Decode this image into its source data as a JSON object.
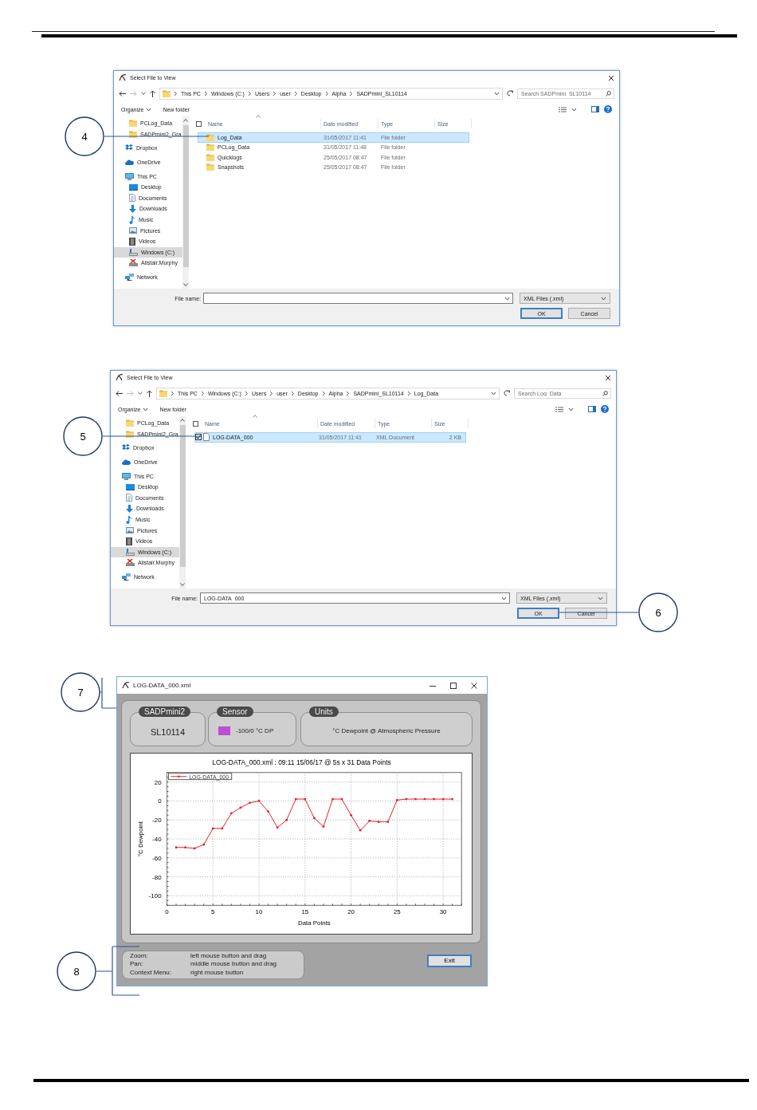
{
  "dialogs": [
    {
      "title": "Select File to View",
      "callouts": [
        "4"
      ],
      "address": [
        "This PC",
        "Windows (C:)",
        "Users",
        "user",
        "Desktop",
        "Alpha",
        "SADPmini_SL10114"
      ],
      "search": {
        "placeholder": "Search SADPmini_SL10114"
      },
      "commands": [
        "Organize",
        "New folder"
      ],
      "sidebar": [
        {
          "label": "PCLog_Data",
          "kind": "folder",
          "selected": false
        },
        {
          "label": "SADPmini2_Gra",
          "kind": "folder",
          "selected": false
        },
        {
          "label": "Dropbox",
          "kind": "dropbox",
          "selected": false
        },
        {
          "label": "OneDrive",
          "kind": "cloud",
          "selected": false
        },
        {
          "label": "This PC",
          "kind": "pc",
          "selected": false,
          "children": [
            {
              "label": "Desktop",
              "kind": "desktop",
              "selected": false
            },
            {
              "label": "Documents",
              "kind": "documents",
              "selected": false
            },
            {
              "label": "Downloads",
              "kind": "downloads",
              "selected": false
            },
            {
              "label": "Music",
              "kind": "music",
              "selected": false
            },
            {
              "label": "Pictures",
              "kind": "pictures",
              "selected": false
            },
            {
              "label": "Videos",
              "kind": "videos",
              "selected": false
            },
            {
              "label": "Windows (C:)",
              "kind": "drive",
              "selected": true
            },
            {
              "label": "Alistair.Murphy",
              "kind": "share",
              "selected": false
            }
          ]
        },
        {
          "label": "Network",
          "kind": "network",
          "selected": false
        }
      ],
      "columns": [
        "Name",
        "Date modified",
        "Type",
        "Size"
      ],
      "select_all": {
        "checked": false
      },
      "rows": [
        {
          "kind": "folder",
          "name": "Log_Data",
          "date": "31/05/2017 11:41",
          "type": "File folder",
          "selected": true
        },
        {
          "kind": "folder",
          "name": "PCLog_Data",
          "date": "31/05/2017 11:48",
          "type": "File folder",
          "selected": false
        },
        {
          "kind": "folder",
          "name": "Quicklogs",
          "date": "25/05/2017 08:47",
          "type": "File folder",
          "selected": false
        },
        {
          "kind": "folder",
          "name": "Snapshots",
          "date": "25/05/2017 08:47",
          "type": "File folder",
          "selected": false
        }
      ],
      "file_name": {
        "label": "File name:"
      },
      "file_type": "XML Files (.xml)",
      "buttons": [
        "OK",
        "Cancel"
      ]
    },
    {
      "title": "Select File to View",
      "callouts": [
        "5",
        "6"
      ],
      "address": [
        "This PC",
        "Windows (C:)",
        "Users",
        "user",
        "Desktop",
        "Alpha",
        "SADPmini_SL10114",
        "Log_Data"
      ],
      "search": {
        "placeholder": "Search Log_Data"
      },
      "commands": [
        "Organize",
        "New folder"
      ],
      "sidebar": [
        {
          "label": "PCLog_Data",
          "kind": "folder",
          "selected": false
        },
        {
          "label": "SADPmini2_Gra",
          "kind": "folder",
          "selected": false
        },
        {
          "label": "Dropbox",
          "kind": "dropbox",
          "selected": false
        },
        {
          "label": "OneDrive",
          "kind": "cloud",
          "selected": false
        },
        {
          "label": "This PC",
          "kind": "pc",
          "selected": false,
          "children": [
            {
              "label": "Desktop",
              "kind": "desktop",
              "selected": false
            },
            {
              "label": "Documents",
              "kind": "documents",
              "selected": false
            },
            {
              "label": "Downloads",
              "kind": "downloads",
              "selected": false
            },
            {
              "label": "Music",
              "kind": "music",
              "selected": false
            },
            {
              "label": "Pictures",
              "kind": "pictures",
              "selected": false
            },
            {
              "label": "Videos",
              "kind": "videos",
              "selected": false
            },
            {
              "label": "Windows (C:)",
              "kind": "drive",
              "selected": true
            },
            {
              "label": "Alistair.Murphy",
              "kind": "share",
              "selected": false
            }
          ]
        },
        {
          "label": "Network",
          "kind": "network",
          "selected": false
        }
      ],
      "columns": [
        "Name",
        "Date modified",
        "Type",
        "Size"
      ],
      "select_all": {
        "checked": false
      },
      "rows": [
        {
          "kind": "file",
          "name": "LOG-DATA_000",
          "date": "31/05/2017 11:41",
          "type": "XML Document",
          "size": "2 KB",
          "selected": true,
          "checked": true
        }
      ],
      "file_name": {
        "label": "File name:",
        "value": "LOG-DATA_000"
      },
      "file_type": "XML Files (.xml)",
      "buttons": [
        "OK",
        "Cancel"
      ]
    }
  ],
  "viewer": {
    "title": "LOG-DATA_000.xml",
    "callouts": [
      "7",
      "8"
    ],
    "groups": [
      {
        "kind": "text",
        "legend": "SADPmini2",
        "value": "SL10114"
      },
      {
        "kind": "swatch",
        "legend": "Sensor",
        "value": "-100/0 °C DP",
        "color": "#bb4fd6"
      },
      {
        "kind": "text",
        "legend": "Units",
        "value": "°C Dewpoint @ Atmospheric Pressure"
      }
    ],
    "chart_data": {
      "type": "line",
      "title": "LOG-DATA_000.xml : 09:11 15/06/17 @ 5s x 31 Data Points",
      "xlabel": "Data Points",
      "ylabel": "°C Dewpoint",
      "x": [
        1,
        2,
        3,
        4,
        5,
        6,
        7,
        8,
        9,
        10,
        11,
        12,
        13,
        14,
        15,
        16,
        17,
        18,
        19,
        20,
        21,
        22,
        23,
        24,
        25,
        26,
        27,
        28,
        29,
        30,
        31
      ],
      "series": [
        {
          "name": "LOG-DATA_000",
          "color": "#e0202a",
          "values": [
            -49,
            -49,
            -50,
            -46,
            -29,
            -29,
            -13,
            -7,
            -2,
            0,
            -11,
            -28,
            -20,
            2,
            2,
            -18,
            -27,
            2,
            2,
            -15,
            -31,
            -21,
            -22,
            -22,
            1,
            2,
            2,
            2,
            2,
            2,
            2
          ]
        }
      ],
      "grid": true,
      "xlim": [
        0,
        32
      ],
      "ylim": [
        -110,
        30
      ],
      "xticks": [
        0,
        5,
        10,
        15,
        20,
        25,
        30
      ],
      "yticks": [
        20,
        0,
        -20,
        -40,
        -60,
        -80,
        -100
      ]
    },
    "help": [
      {
        "action": "Zoom:",
        "binding": "left mouse button and drag"
      },
      {
        "action": "Pan:",
        "binding": "middle mouse button and drag"
      },
      {
        "action": "Context Menu:",
        "binding": "right mouse button"
      }
    ],
    "exit_button": "Exit"
  }
}
